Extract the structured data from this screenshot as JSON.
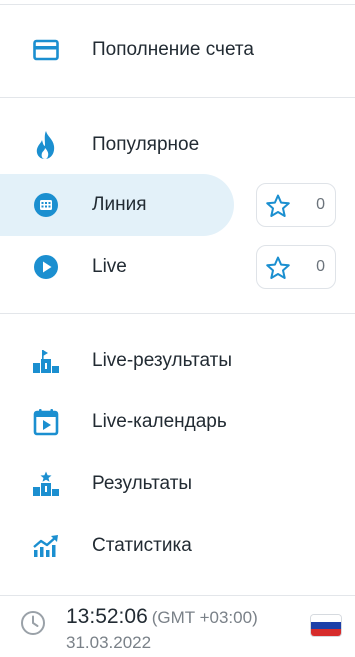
{
  "menu": {
    "topup": {
      "label": "Пополнение счета",
      "icon": "credit-card-icon"
    },
    "popular": {
      "label": "Популярное",
      "icon": "flame-icon"
    },
    "line": {
      "label": "Линия",
      "icon": "calendar-grid-icon",
      "favorites_count": "0"
    },
    "live": {
      "label": "Live",
      "icon": "play-circle-icon",
      "favorites_count": "0"
    },
    "live_results": {
      "label": "Live-результаты",
      "icon": "podium-icon"
    },
    "live_calendar": {
      "label": "Live-календарь",
      "icon": "calendar-play-icon"
    },
    "results": {
      "label": "Результаты",
      "icon": "podium-star-icon"
    },
    "statistics": {
      "label": "Статистика",
      "icon": "chart-trend-icon"
    }
  },
  "footer": {
    "time": "13:52:06",
    "timezone": "(GMT +03:00)",
    "date": "31.03.2022",
    "flag": "russia-flag"
  },
  "colors": {
    "accent": "#1b8fd0",
    "active_bg": "#e3f1f9",
    "text": "#222b33",
    "muted": "#7a8188",
    "divider": "#e3e6ea"
  }
}
